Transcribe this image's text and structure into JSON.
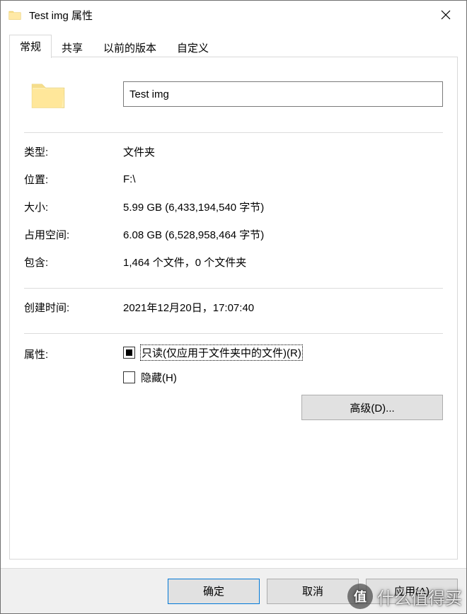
{
  "window": {
    "title": "Test img 属性"
  },
  "tabs": {
    "general": "常规",
    "sharing": "共享",
    "previous": "以前的版本",
    "custom": "自定义"
  },
  "name_input": "Test img",
  "labels": {
    "type": "类型:",
    "location": "位置:",
    "size": "大小:",
    "size_on_disk": "占用空间:",
    "contains": "包含:",
    "created": "创建时间:",
    "attributes": "属性:"
  },
  "values": {
    "type": "文件夹",
    "location": "F:\\",
    "size": "5.99 GB (6,433,194,540 字节)",
    "size_on_disk": "6.08 GB (6,528,958,464 字节)",
    "contains": "1,464 个文件，0 个文件夹",
    "created": "2021年12月20日，17:07:40"
  },
  "attributes": {
    "readonly_label": "只读(仅应用于文件夹中的文件)(R)",
    "hidden_label": "隐藏(H)",
    "advanced_button": "高级(D)..."
  },
  "buttons": {
    "ok": "确定",
    "cancel": "取消",
    "apply": "应用(A)"
  },
  "watermark": {
    "badge": "值",
    "text": "什么值得买"
  }
}
